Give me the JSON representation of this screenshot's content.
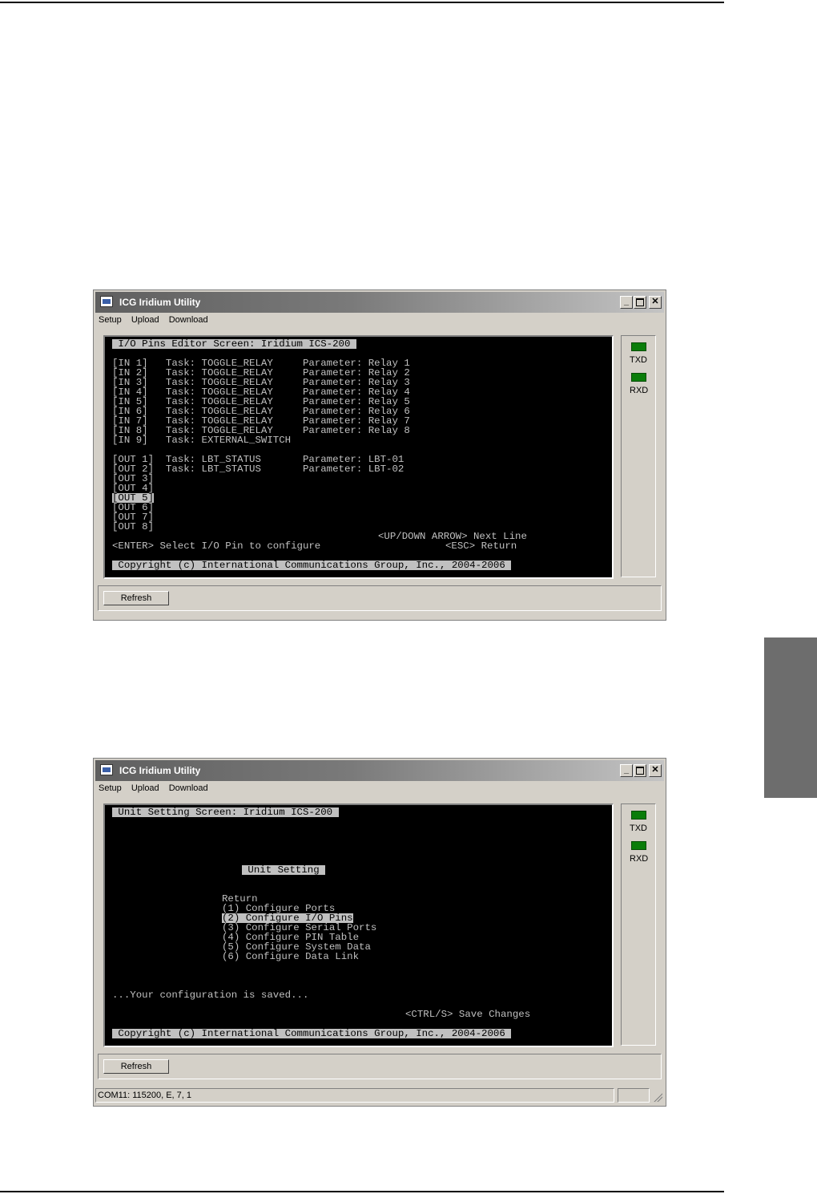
{
  "window1": {
    "title": "ICG Iridium Utility",
    "menu": [
      "Setup",
      "Upload",
      "Download"
    ],
    "terminal": {
      "header": " I/O Pins Editor Screen: Iridium ICS-200 ",
      "lines": [
        "[IN 1]   Task: TOGGLE_RELAY     Parameter: Relay 1",
        "[IN 2]   Task: TOGGLE_RELAY     Parameter: Relay 2",
        "[IN 3]   Task: TOGGLE_RELAY     Parameter: Relay 3",
        "[IN 4]   Task: TOGGLE_RELAY     Parameter: Relay 4",
        "[IN 5]   Task: TOGGLE_RELAY     Parameter: Relay 5",
        "[IN 6]   Task: TOGGLE_RELAY     Parameter: Relay 6",
        "[IN 7]   Task: TOGGLE_RELAY     Parameter: Relay 7",
        "[IN 8]   Task: TOGGLE_RELAY     Parameter: Relay 8",
        "[IN 9]   Task: EXTERNAL_SWITCH",
        "",
        "[OUT 1]  Task: LBT_STATUS       Parameter: LBT-01",
        "[OUT 2]  Task: LBT_STATUS       Parameter: LBT-02",
        "[OUT 3]",
        "[OUT 4]",
        "[OUT 5]",
        "[OUT 6]",
        "[OUT 7]",
        "[OUT 8]"
      ],
      "hint_nav": "<UP/DOWN ARROW> Next Line",
      "hint_enter": "<ENTER> Select I/O Pin to configure",
      "hint_esc": "<ESC> Return",
      "copyright": " Copyright (c) International Communications Group, Inc., 2004-2006 "
    },
    "leds": [
      "TXD",
      "RXD"
    ],
    "refresh_label": "Refresh"
  },
  "window2": {
    "title": "ICG Iridium Utility",
    "menu": [
      "Setup",
      "Upload",
      "Download"
    ],
    "terminal": {
      "header": " Unit Setting Screen: Iridium ICS-200 ",
      "subheader": " Unit Setting ",
      "menu_items": [
        "Return",
        "(1) Configure Ports",
        "(2) Configure I/O Pins",
        "(3) Configure Serial Ports",
        "(4) Configure PIN Table",
        "(5) Configure System Data",
        "(6) Configure Data Link"
      ],
      "saved_msg": "...Your configuration is saved...",
      "hint_save": "<CTRL/S> Save Changes",
      "copyright": " Copyright (c) International Communications Group, Inc., 2004-2006 "
    },
    "leds": [
      "TXD",
      "RXD"
    ],
    "refresh_label": "Refresh",
    "status_text": "COM11: 115200, E, 7, 1"
  },
  "colors": {
    "terminal_bg": "#000000",
    "terminal_text": "#c0c0c0",
    "led_green": "#0a7d0a",
    "side_tab": "#6d6d6d"
  }
}
